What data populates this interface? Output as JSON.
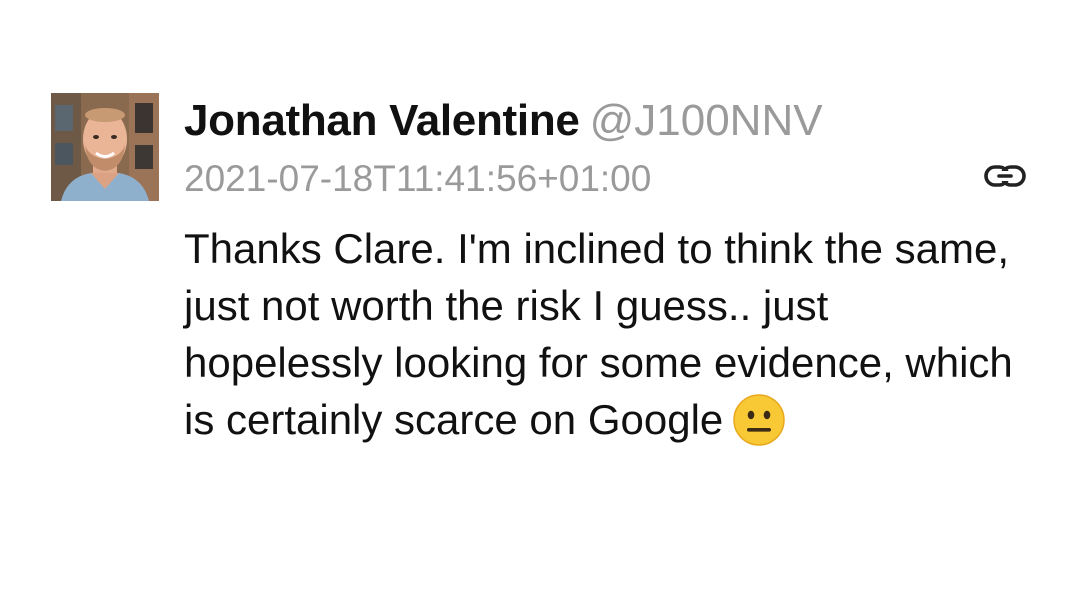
{
  "tweet": {
    "author": {
      "display_name": "Jonathan Valentine",
      "handle": "@J100NNV"
    },
    "timestamp": "2021-07-18T11:41:56+01:00",
    "text": "Thanks Clare. I'm inclined to think the same, just not worth the risk I guess.. just hopelessly looking for some evidence, which is certainly scarce on Google",
    "emoji": "neutral-face-emoji",
    "link_icon": "link-icon",
    "avatar_icon": "profile-photo"
  }
}
